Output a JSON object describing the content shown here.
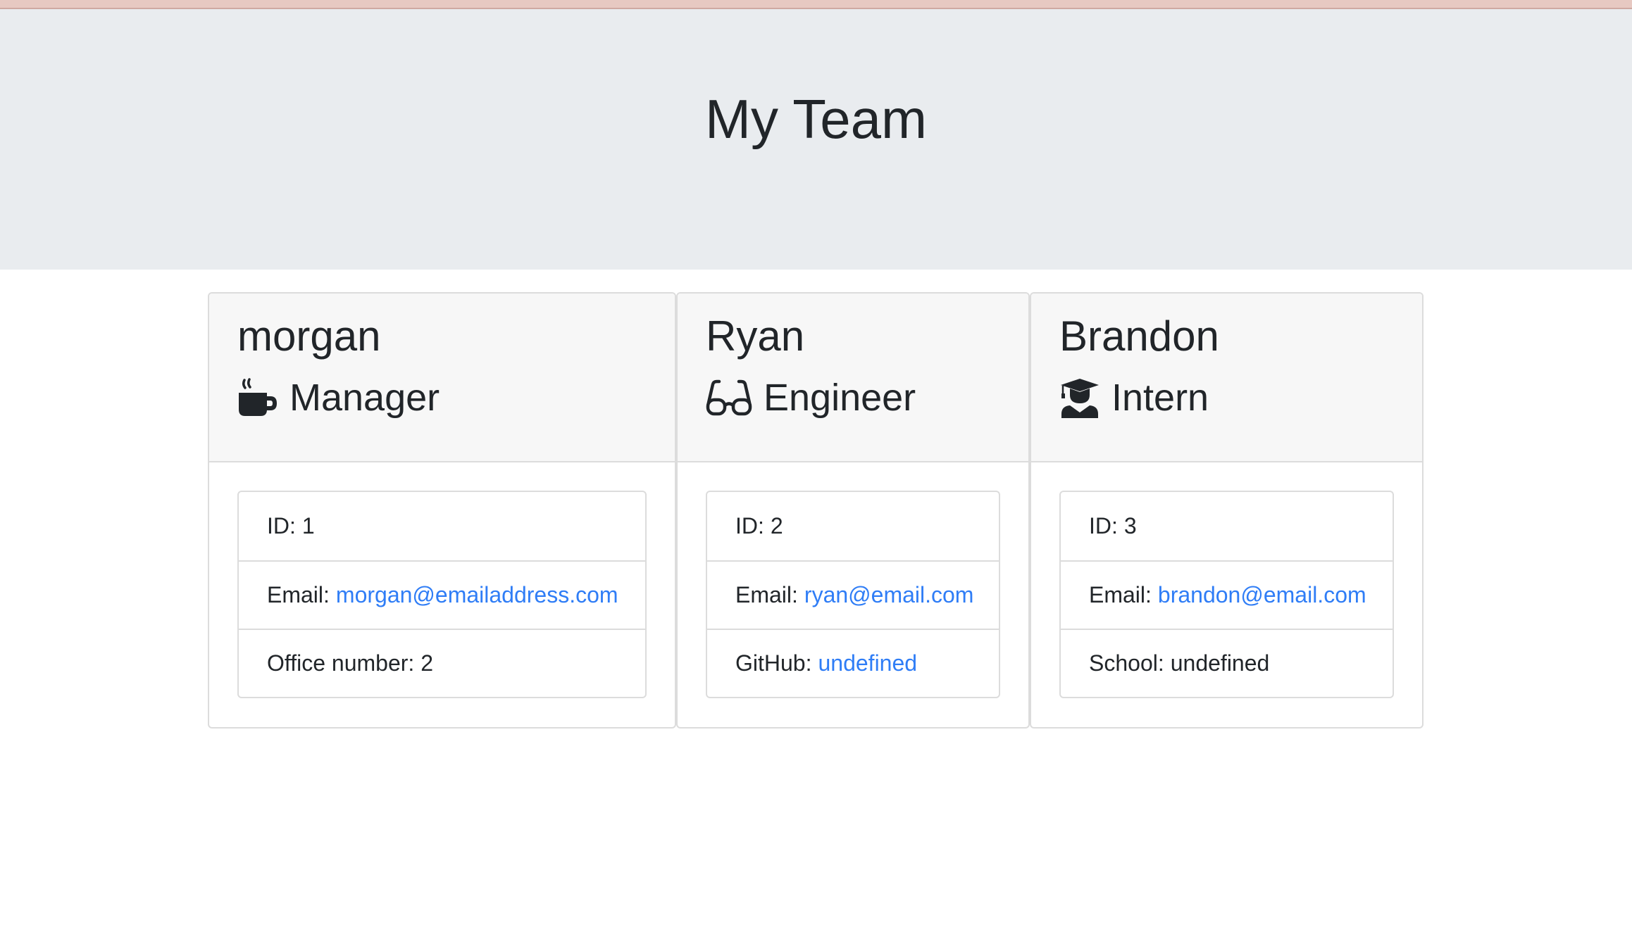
{
  "header": {
    "title": "My Team"
  },
  "colors": {
    "jumbotron_bg": "#e9ecef",
    "card_header_bg": "#f7f7f7",
    "link": "#2f7df6",
    "text": "#212529",
    "top_strip": "#e7c9c2"
  },
  "cards": [
    {
      "name": "morgan",
      "role": "Manager",
      "icon": "coffee-mug-icon",
      "id_label": "ID:",
      "id_value": "1",
      "email_label": "Email:",
      "email_value": "morgan@emailaddress.com",
      "extra_label": "Office number:",
      "extra_value": "2"
    },
    {
      "name": "Ryan",
      "role": "Engineer",
      "icon": "glasses-icon",
      "id_label": "ID:",
      "id_value": "2",
      "email_label": "Email:",
      "email_value": "ryan@email.com",
      "extra_label": "GitHub:",
      "extra_value": "undefined"
    },
    {
      "name": "Brandon",
      "role": "Intern",
      "icon": "graduate-icon",
      "id_label": "ID:",
      "id_value": "3",
      "email_label": "Email:",
      "email_value": "brandon@email.com",
      "extra_label": "School:",
      "extra_value": "undefined"
    }
  ]
}
